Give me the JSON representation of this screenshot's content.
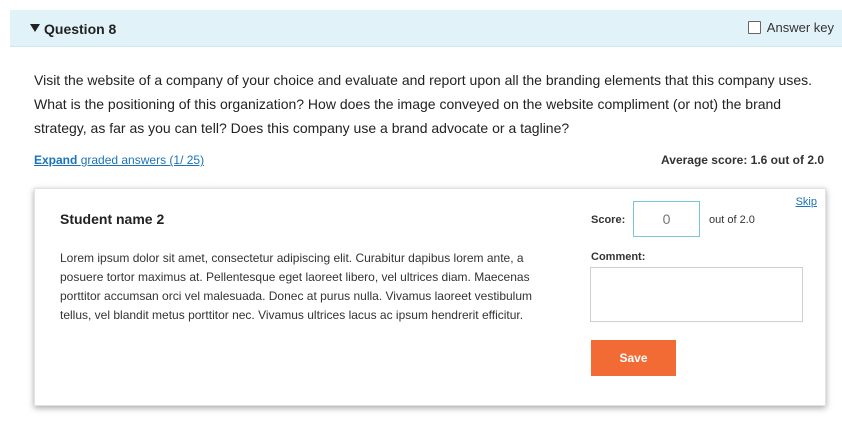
{
  "question": {
    "title": "Question 8",
    "answer_key_label": "Answer key",
    "text": "Visit the website of a company of your choice and evaluate and report upon all the branding elements that this company uses. What is the positioning of this organization? How does the image conveyed on the website compliment (or not) the brand strategy, as far as you can tell? Does this company use a brand advocate or a tagline?"
  },
  "graded": {
    "expand_label": "Expand",
    "expand_rest": "graded answers (1/ 25)",
    "average_score": "Average score: 1.6 out of 2.0"
  },
  "card": {
    "skip_label": "Skip",
    "student_name": "Student name 2",
    "response": "Lorem ipsum dolor sit amet, consectetur adipiscing elit. Curabitur dapibus lorem ante, a posuere tortor maximus at. Pellentesque eget laoreet libero, vel ultrices diam. Maecenas porttitor accumsan orci vel malesuada. Donec at purus nulla. Vivamus laoreet vestibulum tellus, vel blandit metus porttitor nec. Vivamus ultrices lacus ac ipsum hendrerit efficitur.",
    "score_label": "Score:",
    "score_placeholder": "0",
    "out_of": "out of 2.0",
    "comment_label": "Comment:",
    "comment_value": "",
    "save_label": "Save"
  },
  "colors": {
    "header_bg": "#e1f3f8",
    "link": "#1a73b8",
    "save_button": "#f26b35"
  }
}
